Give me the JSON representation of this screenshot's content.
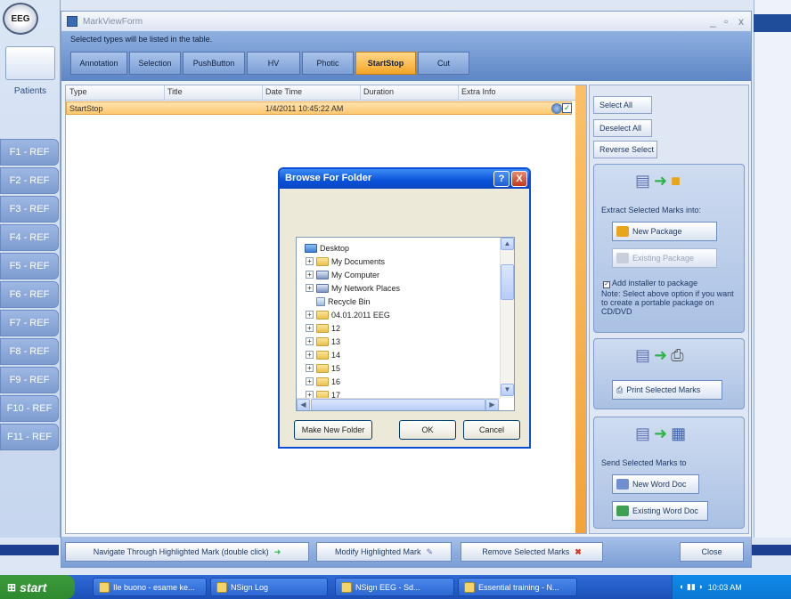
{
  "window": {
    "title": "MarkViewForm"
  },
  "sidebar": {
    "logo": "EEG",
    "patients_label": "Patients",
    "ref_tabs": [
      "F1 - REF",
      "F2 - REF",
      "F3 - REF",
      "F4 - REF",
      "F5 - REF",
      "F6 - REF",
      "F7 - REF",
      "F8 - REF",
      "F9 - REF",
      "F10 - REF",
      "F11 - REF"
    ]
  },
  "filter": {
    "caption": "Selected types will be listed in the table.",
    "buttons": [
      "Annotation",
      "Selection",
      "PushButton",
      "HV",
      "Photic",
      "StartStop",
      "Cut"
    ],
    "active": "StartStop"
  },
  "table": {
    "columns": [
      "Type",
      "Title",
      "Date Time",
      "Duration",
      "Extra Info"
    ],
    "rows": [
      {
        "type": "StartStop",
        "title": "",
        "datetime": "1/4/2011 10:45:22 AM",
        "duration": "",
        "extra": ""
      }
    ]
  },
  "right_panel": {
    "select_all": "Select All",
    "deselect_all": "Deselect All",
    "reverse_select": "Reverse Select",
    "extract_caption": "Extract Selected Marks into:",
    "new_package": "New Package",
    "existing_package": "Existing Package",
    "add_installer": "Add installer to package",
    "add_installer_note": "Note: Select above option if you want to create a portable package on CD/DVD",
    "print_marks": "Print Selected Marks",
    "send_caption": "Send Selected Marks to",
    "new_word": "New Word Doc",
    "existing_word": "Existing Word Doc"
  },
  "bottom": {
    "navigate": "Navigate Through Highlighted Mark (double click)",
    "modify": "Modify Highlighted Mark",
    "remove": "Remove Selected Marks",
    "close": "Close"
  },
  "dialog": {
    "title": "Browse For Folder",
    "help": "?",
    "close": "X",
    "tree": [
      {
        "label": "Desktop",
        "indent": 0,
        "expander": "",
        "icon": "desktop-icon"
      },
      {
        "label": "My Documents",
        "indent": 1,
        "expander": "+",
        "icon": "folder-icon"
      },
      {
        "label": "My Computer",
        "indent": 1,
        "expander": "+",
        "icon": "computer-icon"
      },
      {
        "label": "My Network Places",
        "indent": 1,
        "expander": "+",
        "icon": "network-icon"
      },
      {
        "label": "Recycle Bin",
        "indent": 1,
        "expander": "",
        "icon": "recycle-bin-icon"
      },
      {
        "label": "04.01.2011 EEG",
        "indent": 1,
        "expander": "+",
        "icon": "folder-icon"
      },
      {
        "label": "12",
        "indent": 1,
        "expander": "+",
        "icon": "folder-icon"
      },
      {
        "label": "13",
        "indent": 1,
        "expander": "+",
        "icon": "folder-icon"
      },
      {
        "label": "14",
        "indent": 1,
        "expander": "+",
        "icon": "folder-icon"
      },
      {
        "label": "15",
        "indent": 1,
        "expander": "+",
        "icon": "folder-icon"
      },
      {
        "label": "16",
        "indent": 1,
        "expander": "+",
        "icon": "folder-icon"
      },
      {
        "label": "17",
        "indent": 1,
        "expander": "+",
        "icon": "folder-icon"
      }
    ],
    "make_new_folder": "Make New Folder",
    "ok": "OK",
    "cancel": "Cancel"
  },
  "taskbar": {
    "start": "start",
    "tasks": [
      "Ile buono - esame ke...",
      "NSign Log",
      "NSign EEG - Sd...",
      "Essential training - N..."
    ],
    "tray_time": "10:03 AM"
  }
}
